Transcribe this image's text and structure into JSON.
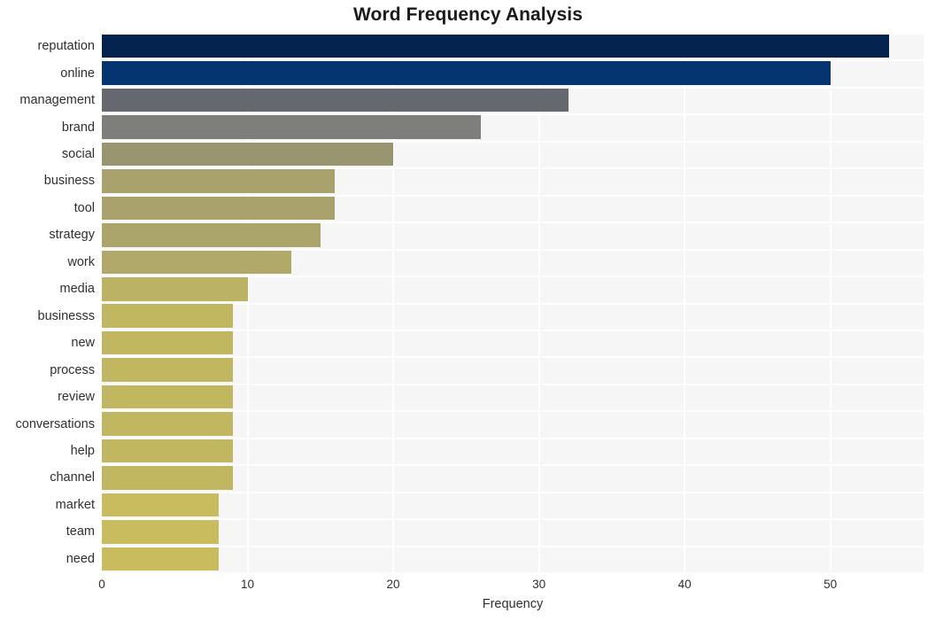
{
  "chart_data": {
    "type": "bar",
    "orientation": "horizontal",
    "title": "Word Frequency Analysis",
    "xlabel": "Frequency",
    "ylabel": "",
    "categories": [
      "reputation",
      "online",
      "management",
      "brand",
      "social",
      "business",
      "tool",
      "strategy",
      "work",
      "media",
      "businesss",
      "new",
      "process",
      "review",
      "conversations",
      "help",
      "channel",
      "market",
      "team",
      "need"
    ],
    "values": [
      54,
      50,
      32,
      26,
      20,
      16,
      16,
      15,
      13,
      10,
      9,
      9,
      9,
      9,
      9,
      9,
      9,
      8,
      8,
      8
    ],
    "bar_colors": [
      "#05234f",
      "#043571",
      "#66686f",
      "#7e7f7a",
      "#9a9571",
      "#a9a26c",
      "#a9a26c",
      "#aba46b",
      "#b0a969",
      "#bcb263",
      "#c2b761",
      "#c2b761",
      "#c2b761",
      "#c2b761",
      "#c2b761",
      "#c2b761",
      "#c2b761",
      "#c8bc5e",
      "#c8bc5e",
      "#c8bc5e"
    ],
    "xlim": [
      0,
      56.4
    ],
    "xticks": [
      0,
      10,
      20,
      30,
      40,
      50
    ],
    "xtick_labels": [
      "0",
      "10",
      "20",
      "30",
      "40",
      "50"
    ],
    "grid": true,
    "grid_color": "#ffffff",
    "plot_background": "#f6f6f6",
    "figure_background": "#ffffff",
    "legend": null
  }
}
